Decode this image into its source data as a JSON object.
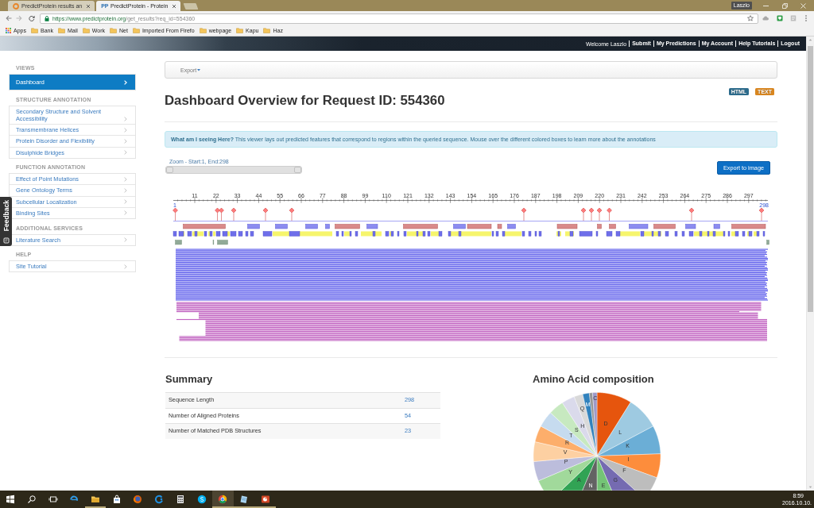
{
  "browser": {
    "tabs": [
      {
        "title": "PredictProtein results an",
        "selected": false
      },
      {
        "title": "PredictProtein - Protein",
        "badge": "PP",
        "selected": true
      }
    ],
    "user": "Laszlo",
    "address": {
      "host": "https://www.predictprotein.org",
      "path": "/get_results?req_id=554360"
    },
    "bookmarks": [
      {
        "label": "Apps",
        "kind": "apps"
      },
      {
        "label": "Bank",
        "kind": "folder"
      },
      {
        "label": "Mail",
        "kind": "folder"
      },
      {
        "label": "Work",
        "kind": "folder"
      },
      {
        "label": "Net",
        "kind": "folder"
      },
      {
        "label": "Imported From Firefo",
        "kind": "folder"
      },
      {
        "label": "webpage",
        "kind": "folder"
      },
      {
        "label": "Kapu",
        "kind": "folder"
      },
      {
        "label": "Haz",
        "kind": "folder"
      }
    ]
  },
  "header": {
    "welcome": "Welcome Laszlo",
    "links": [
      "Submit",
      "My Predictions",
      "My Account",
      "Help Tutorials",
      "Logout"
    ]
  },
  "sidebar": {
    "sections": [
      {
        "title": "VIEWS",
        "items": [
          {
            "label": "Dashboard",
            "selected": true
          }
        ]
      },
      {
        "title": "STRUCTURE ANNOTATION",
        "items": [
          {
            "label": "Secondary Structure and Solvent Accessibility",
            "selected": false
          },
          {
            "label": "Transmembrane Helices",
            "selected": false
          },
          {
            "label": "Protein Disorder and Flexibility",
            "selected": false
          },
          {
            "label": "Disulphide Bridges",
            "selected": false
          }
        ]
      },
      {
        "title": "FUNCTION ANNOTATION",
        "items": [
          {
            "label": "Effect of Point Mutations",
            "selected": false
          },
          {
            "label": "Gene Ontology Terms",
            "selected": false
          },
          {
            "label": "Subcellular Localization",
            "selected": false
          },
          {
            "label": "Binding Sites",
            "selected": false
          }
        ]
      },
      {
        "title": "ADDITIONAL SERVICES",
        "items": [
          {
            "label": "Literature Search",
            "selected": false
          }
        ]
      },
      {
        "title": "HELP",
        "items": [
          {
            "label": "Site Tutorial",
            "selected": false
          }
        ]
      }
    ]
  },
  "feedback": {
    "label": "Feedback"
  },
  "toolbar": {
    "menu": "Export"
  },
  "title": "Dashboard Overview for Request ID: 554360",
  "formats": [
    {
      "label": "HTML",
      "color": "#2c6b8c"
    },
    {
      "label": "TEXT",
      "color": "#d9861f"
    }
  ],
  "info": "**What am I seeing Here?** This viewer lays out predicted features that correspond to regions within the queried sequence. Mouse over the different colored boxes to learn more about the annotations",
  "zoom": {
    "label": "Zoom - Start:1, End:298",
    "level": 1
  },
  "export_button": "Export to image",
  "viewer": {
    "start": "1",
    "end": "298",
    "ticks": [
      "11",
      "22",
      "33",
      "44",
      "55",
      "66",
      "77",
      "88",
      "99",
      "110",
      "121",
      "132",
      "143",
      "154",
      "165",
      "176",
      "187",
      "198",
      "209",
      "220",
      "231",
      "242",
      "253",
      "264",
      "275",
      "286",
      "297"
    ]
  },
  "summary": {
    "title": "Summary",
    "rows": [
      {
        "label": "Sequence Length",
        "value": "298"
      },
      {
        "label": "Number of Aligned Proteins",
        "value": "54"
      },
      {
        "label": "Number of Matched PDB Structures",
        "value": "23"
      }
    ]
  },
  "composition": {
    "title": "Amino Acid composition",
    "slice_labels": [
      "Q",
      "M",
      "C",
      "H",
      "D",
      "S",
      "L",
      "T",
      "R",
      "K",
      "V",
      "I",
      "P",
      "Y",
      "F",
      "A",
      "G",
      "N",
      "E"
    ]
  },
  "taskbar": {
    "apps": [
      {
        "running": false,
        "selected": false
      },
      {
        "running": true,
        "selected": false
      },
      {
        "running": false,
        "selected": false
      },
      {
        "running": false,
        "selected": false
      },
      {
        "running": false,
        "selected": false
      },
      {
        "running": false,
        "selected": false
      },
      {
        "running": false,
        "selected": false
      },
      {
        "running": true,
        "selected": true
      },
      {
        "running": true,
        "selected": false
      },
      {
        "running": true,
        "selected": false
      }
    ],
    "time": "8:59",
    "date": "2016.10.10."
  }
}
